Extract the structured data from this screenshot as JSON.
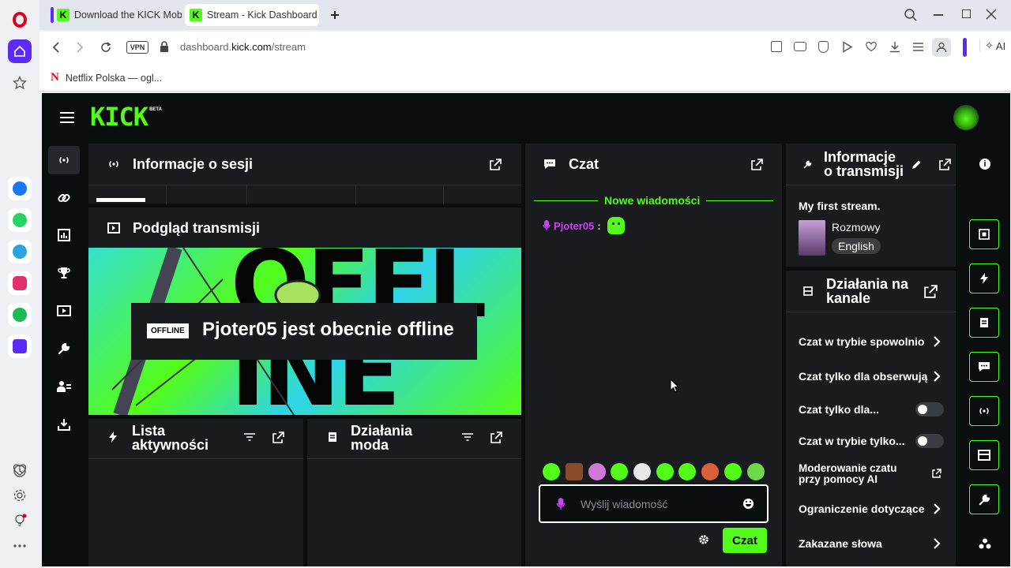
{
  "browser": {
    "tabs": [
      {
        "title": "Download the KICK Mobile"
      },
      {
        "title": "Stream - Kick Dashboard"
      }
    ],
    "vpn_label": "VPN",
    "url_prefix": "dashboard.",
    "url_domain": "kick.com",
    "url_path": "/stream",
    "ai_label": "AI",
    "bookmark": "Netflix Polska — ogl..."
  },
  "app": {
    "logo": "KICK",
    "logo_badge": "BETA"
  },
  "session": {
    "title": "Informacje o sesji"
  },
  "preview": {
    "title": "Podgląd transmisji",
    "offline_badge": "OFFLINE",
    "offline_text": "Pjoter05 jest obecnie offline",
    "bg_word": "OFFLINE"
  },
  "activity": {
    "title_line1": "Lista",
    "title_line2": "aktywności"
  },
  "mod_actions": {
    "title_line1": "Działania",
    "title_line2": "moda"
  },
  "chat": {
    "title": "Czat",
    "new_messages": "Nowe wiadomości",
    "message_user": "Pjoter05",
    "input_placeholder": "Wyślij wiadomość",
    "send_label": "Czat"
  },
  "stream_info": {
    "title_line1": "Informacje",
    "title_line2": "o transmisji",
    "stream_title": "My first stream.",
    "category": "Rozmowy",
    "language": "English"
  },
  "channel_actions": {
    "title_line1": "Działania na",
    "title_line2": "kanale",
    "items": [
      {
        "label": "Czat w trybie spowolnio"
      },
      {
        "label": "Czat tylko dla obserwują"
      },
      {
        "label": "Czat tylko dla..."
      },
      {
        "label": "Czat w trybie tylko..."
      },
      {
        "label_line1": "Moderowanie czatu",
        "label_line2": "przy pomocy AI"
      },
      {
        "label": "Ograniczenie dotyczące"
      },
      {
        "label": "Zakazane słowa"
      }
    ]
  },
  "colors": {
    "accent": "#53fc18",
    "panel": "#191b1f",
    "bg": "#0b0e0f"
  }
}
